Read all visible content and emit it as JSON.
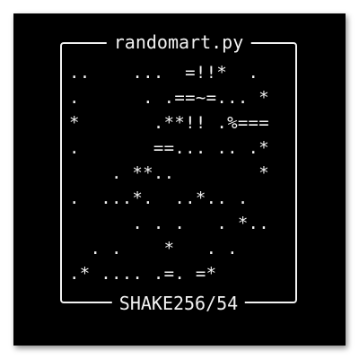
{
  "randomart": {
    "title": "randomart.py",
    "footer": "SHAKE256/54",
    "rows": [
      "..    ...  =!!*  .",
      ".      . .==~=... *",
      "*       .**!! .%===",
      ".       ==... .. .*",
      "    . **..        *",
      ".  ...*.  ..*.. .",
      "      . . .   . *..",
      "  . .    *   . .",
      ".* .... .=. =*"
    ]
  },
  "colors": {
    "background": "#000000",
    "foreground": "#f2f2f2"
  }
}
